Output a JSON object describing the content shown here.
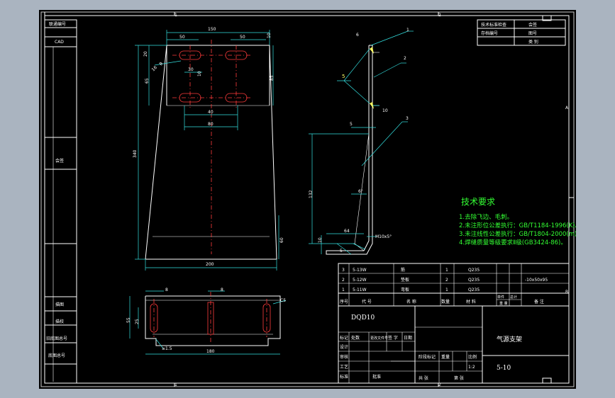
{
  "colors": {
    "background": "#000000",
    "frame": "#ffffff",
    "dimension": "#33e0e0",
    "centerline": "#ff3b3b",
    "notes": "#22d33a",
    "weld": "#ffff66"
  },
  "frame": {
    "zone_top": [
      "1",
      "2",
      "3"
    ],
    "zone_bottom": [
      "1",
      "2",
      "3"
    ],
    "zone_right": [
      "A",
      "B"
    ]
  },
  "left_column": {
    "cells": [
      "联通编号",
      "CAD",
      "会签",
      "描图",
      "描校",
      "旧底图总号",
      "底图总号"
    ]
  },
  "top_right_table": {
    "row1": [
      "技术标准检查",
      "会签"
    ],
    "row2": [
      "存档编号",
      "图号"
    ],
    "row3": [
      "",
      "类 别"
    ]
  },
  "front_view": {
    "dims": {
      "overall_width": "150",
      "top_left_50": "50",
      "top_right_50": "50",
      "top_10": "10",
      "side_20": "20",
      "side_16": "16",
      "r": "R",
      "side_65": "65",
      "inner_30": "30",
      "small_10": "10",
      "side_85": "85",
      "center_40": "40",
      "center_80": "80",
      "height_340": "340",
      "bottom_60": "60",
      "base_200": "200"
    }
  },
  "side_view": {
    "dims": {
      "top_6": "6",
      "weld_5_top": "5",
      "weld_10": "10",
      "weld_5_mid": "5",
      "h_132": "132",
      "angle_6": "6°",
      "bottom_10": "10",
      "bottom_64": "64",
      "thread": "M10x5°",
      "gap_5": "5"
    },
    "callouts": [
      "1",
      "2",
      "3"
    ]
  },
  "bottom_view": {
    "dims": {
      "top_8a": "8",
      "top_8b": "8",
      "side_55": "55",
      "side_25": "25",
      "label_c5": "C5",
      "small": "≥1.5",
      "width_180": "180"
    }
  },
  "notes": {
    "heading": "技术要求",
    "lines": [
      "1.去除飞边、毛刺。",
      "2.未注形位公差执行：GB/T1184-1996(K)。",
      "3.未注线性公差执行：GB/T1804-2000(m)。",
      "4.焊缝质量等级要求Ⅱ级(GB3424-86)。"
    ]
  },
  "bom": {
    "rows": [
      {
        "no": "3",
        "code": "5-13W",
        "name": "筋",
        "qty": "1",
        "material": "Q235",
        "remark": ""
      },
      {
        "no": "2",
        "code": "5-12W",
        "name": "垫板",
        "qty": "2",
        "material": "Q235",
        "remark": "-10x50x95"
      },
      {
        "no": "1",
        "code": "5-11W",
        "name": "弯板",
        "qty": "1",
        "material": "Q235",
        "remark": ""
      }
    ],
    "header": {
      "no": "序号",
      "code": "代  号",
      "name": "名  称",
      "qty": "数量",
      "material": "材  料",
      "single": "单件",
      "total": "总计",
      "weight": "重  量",
      "remark": "备  注"
    }
  },
  "title_block": {
    "project": "DQD10",
    "part_name": "气源支架",
    "drawing_no": "5-10",
    "rev_labels": [
      "标记",
      "处数",
      "更改文件号",
      "签 字",
      "日期"
    ],
    "sign_labels": [
      "设计",
      "审核",
      "工艺",
      "标准",
      "批准"
    ],
    "stage_label": "阶段标记",
    "weight_label": "重量",
    "scale_label": "比例",
    "scale": "1:2",
    "sheet_label": "共 张",
    "page_label": "第 张"
  }
}
